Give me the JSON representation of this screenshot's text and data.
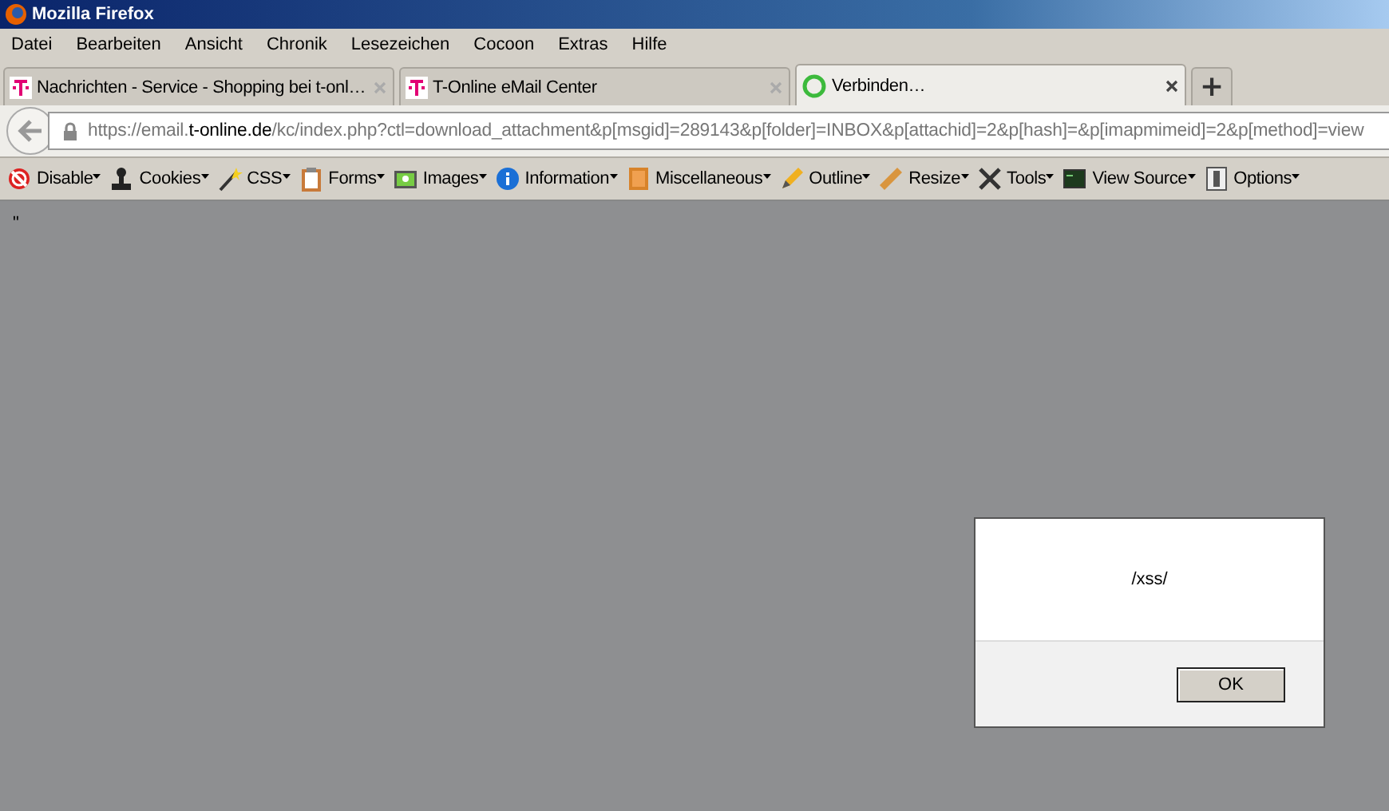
{
  "window": {
    "title": "Mozilla Firefox"
  },
  "menu": [
    "Datei",
    "Bearbeiten",
    "Ansicht",
    "Chronik",
    "Lesezeichen",
    "Cocoon",
    "Extras",
    "Hilfe"
  ],
  "tabs": [
    {
      "label": "Nachrichten - Service - Shopping bei t-onl…",
      "selected": false,
      "loading": false
    },
    {
      "label": "T-Online eMail Center",
      "selected": false,
      "loading": false
    },
    {
      "label": "Verbinden…",
      "selected": true,
      "loading": true
    }
  ],
  "new_tab": "+",
  "address": {
    "prefix": "https://email.",
    "domain": "t-online.de",
    "path": "/kc/index.php?ctl=download_attachment&p[msgid]=289143&p[folder]=INBOX&p[attachid]=2&p[hash]=&p[imapmimeid]=2&p[method]=view"
  },
  "toolbar": [
    "Disable",
    "Cookies",
    "CSS",
    "Forms",
    "Images",
    "Information",
    "Miscellaneous",
    "Outline",
    "Resize",
    "Tools",
    "View Source",
    "Options"
  ],
  "page_text": "\"",
  "dialog": {
    "message": "/xss/",
    "button": "OK"
  }
}
